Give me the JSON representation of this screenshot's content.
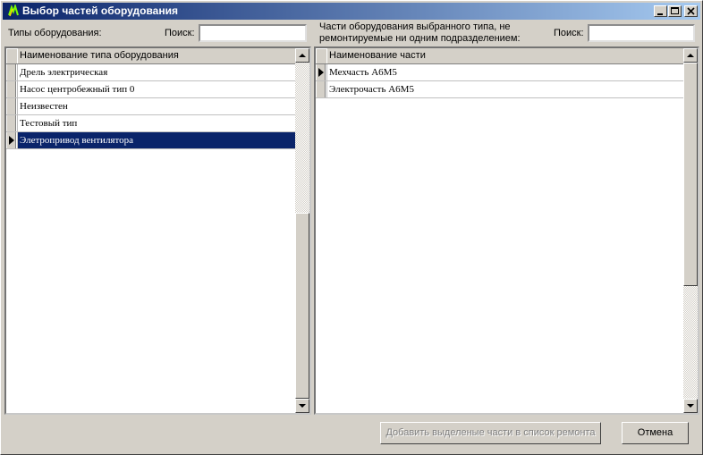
{
  "window": {
    "title": "Выбор частей оборудования",
    "controls": [
      "minimize",
      "maximize",
      "close"
    ]
  },
  "left": {
    "label": "Типы оборудования:",
    "search_label": "Поиск:",
    "search_value": "",
    "grid": {
      "column_header": "Наименование типа оборудования",
      "rows": [
        "Дрель электрическая",
        "Насос центробежный тип 0",
        "Неизвестен",
        "Тестовый тип",
        "Элетропривод вентилятора"
      ],
      "selected_index": 4
    }
  },
  "right": {
    "label_line1": "Части оборудования  выбранного типа, не",
    "label_line2": "ремонтируемые ни одним подразделением:",
    "search_label": "Поиск:",
    "search_value": "",
    "grid": {
      "column_header": "Наименование части",
      "rows": [
        "Мехчасть А6М5",
        "Электрочасть А6М5"
      ],
      "current_index": 0
    }
  },
  "footer": {
    "add_button": "Добавить выделеные части в список ремонта",
    "cancel_button": "Отмена"
  },
  "colors": {
    "titlebar_start": "#0a246a",
    "titlebar_end": "#a6caf0",
    "selection": "#0a246a",
    "face": "#d4d0c8"
  }
}
